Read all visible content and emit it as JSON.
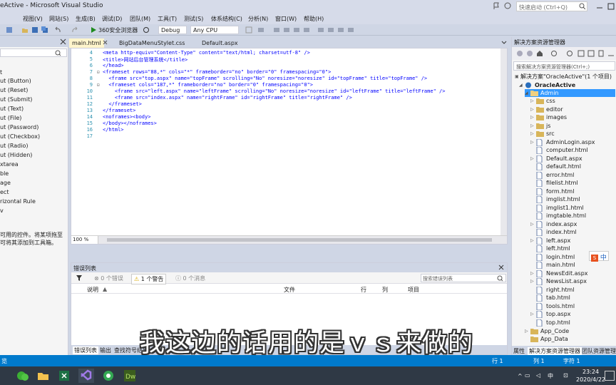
{
  "window": {
    "title": "eActive - Microsoft Visual Studio"
  },
  "quick_launch": {
    "placeholder": "快速启动 (Ctrl+Q)"
  },
  "menu": [
    "视图(V)",
    "网站(S)",
    "生成(B)",
    "调试(D)",
    "团队(M)",
    "工具(T)",
    "测试(S)",
    "体系结构(C)",
    "分析(N)",
    "窗口(W)",
    "帮助(H)"
  ],
  "toolbar": {
    "run_label": "360安全浏览器",
    "config": "Debug",
    "platform": "Any CPU"
  },
  "toolbox": {
    "items": [
      "t",
      "ut (Button)",
      "ut (Reset)",
      "ut (Submit)",
      "ut (Text)",
      "ut (File)",
      "ut (Password)",
      "ut (Checkbox)",
      "ut (Radio)",
      "ut (Hidden)",
      "xtarea",
      "ble",
      "age",
      "ect",
      "rizontal Rule",
      "v"
    ],
    "hint_line1": "可用的控件。将某项拖至",
    "hint_line2": "可将其添加到工具箱。"
  },
  "tabs": [
    "main.html",
    "BigDataMenuStylet.css",
    "Default.aspx"
  ],
  "editor": {
    "lines": [
      {
        "n": "4",
        "text": "<meta http-equiv=\"Content-Type\" content=\"text/html; charset=utf-8\" />"
      },
      {
        "n": "5",
        "text": "<title>网站后台管理系统</title>"
      },
      {
        "n": "6",
        "text": "</head>"
      },
      {
        "n": "7",
        "text": "<frameset rows=\"88,*\" cols=\"*\" frameborder=\"no\" border=\"0\" framespacing=\"0\">"
      },
      {
        "n": "8",
        "text": "  <frame src=\"top.aspx\" name=\"topFrame\" scrolling=\"No\" noresize=\"noresize\" id=\"topFrame\" title=\"topFrame\" />"
      },
      {
        "n": "9",
        "text": "  <frameset cols=\"187,*\" frameborder=\"no\" border=\"0\" framespacing=\"0\">"
      },
      {
        "n": "10",
        "text": "    <frame src=\"left.aspx\" name=\"leftFrame\" scrolling=\"No\" noresize=\"noresize\" id=\"leftFrame\" title=\"leftFrame\" />"
      },
      {
        "n": "11",
        "text": "    <frame src=\"index.aspx\" name=\"rightFrame\" id=\"rightFrame\" title=\"rightFrame\" />"
      },
      {
        "n": "12",
        "text": "  </frameset>"
      },
      {
        "n": "13",
        "text": "</frameset>"
      },
      {
        "n": "14",
        "text": "<noframes><body>"
      },
      {
        "n": "15",
        "text": "</body></noframes>"
      },
      {
        "n": "16",
        "text": "</html>"
      },
      {
        "n": "17",
        "text": ""
      }
    ],
    "zoom": "100 %"
  },
  "errors": {
    "title": "错误列表",
    "errors": "0 个错误",
    "warnings": "1 个警告",
    "messages": "0 个消息",
    "search_placeholder": "搜索错误列表",
    "columns": [
      "说明",
      "文件",
      "行",
      "列",
      "项目"
    ],
    "tabs": [
      "错误列表",
      "输出",
      "查找符号结果"
    ]
  },
  "solution_explorer": {
    "title": "解决方案资源管理器",
    "search_placeholder": "搜索解决方案资源管理器(Ctrl+;)",
    "solution": "解决方案\"OracleActive\"(1 个项目)",
    "project": "OracleActive",
    "folder": "Admin",
    "children": [
      "css",
      "editor",
      "images",
      "js",
      "src",
      "AdminLogin.aspx",
      "computer.html",
      "Default.aspx",
      "default.html",
      "error.html",
      "filelist.html",
      "form.html",
      "imglist.html",
      "imglist1.html",
      "imgtable.html",
      "index.aspx",
      "index.html",
      "left.aspx",
      "left.html",
      "login.html",
      "main.html",
      "NewsEdit.aspx",
      "NewsList.aspx",
      "right.html",
      "tab.html",
      "tools.html",
      "top.aspx",
      "top.html"
    ],
    "after": [
      "App_Code",
      "App_Data"
    ],
    "tabs": [
      "属性",
      "解决方案资源管理器",
      "团队资源管理器"
    ]
  },
  "status": {
    "left": "览",
    "line": "行 1",
    "col": "列 1",
    "char": "字符 1"
  },
  "tray": {
    "time": "23:24",
    "date": "2020/4/22",
    "ime": "中"
  },
  "ime_badge": "中",
  "subtitle": "我这边的话用的是ｖｓ来做的"
}
